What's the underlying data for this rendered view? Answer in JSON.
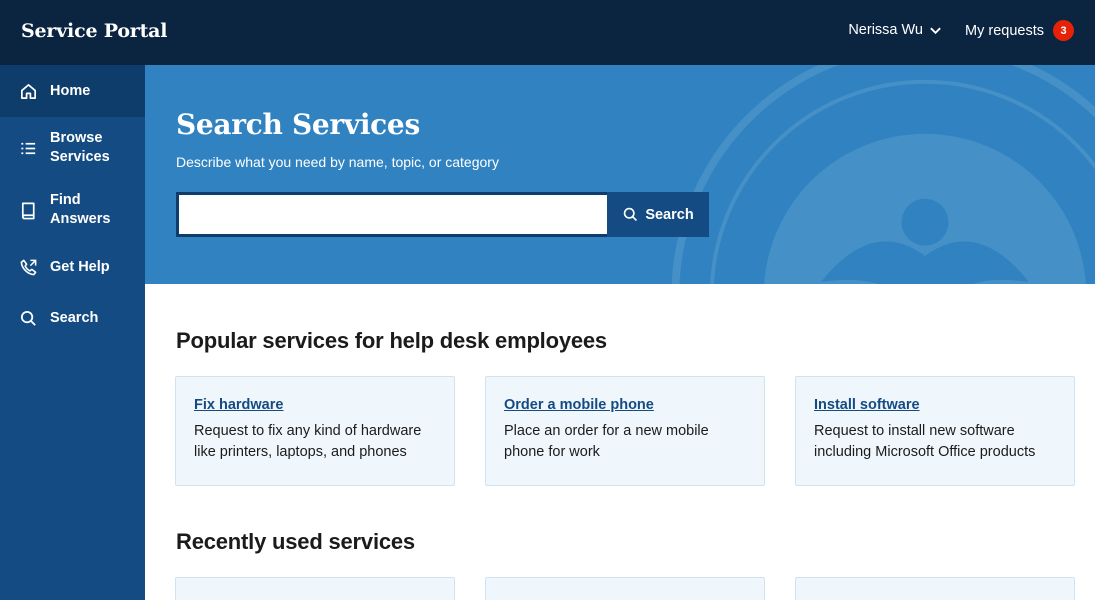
{
  "header": {
    "brand": "Service Portal",
    "user_name": "Nerissa Wu",
    "requests_label": "My requests",
    "requests_count": "3"
  },
  "sidebar": {
    "items": [
      {
        "label": "Home",
        "icon": "home-icon"
      },
      {
        "label": "Browse Services",
        "icon": "list-icon"
      },
      {
        "label": "Find Answers",
        "icon": "book-icon"
      },
      {
        "label": "Get Help",
        "icon": "phone-icon"
      },
      {
        "label": "Search",
        "icon": "search-icon"
      }
    ]
  },
  "hero": {
    "title": "Search Services",
    "subtitle": "Describe what you need by name, topic, or category",
    "search_value": "",
    "search_button": "Search"
  },
  "popular": {
    "title": "Popular services for help desk employees",
    "cards": [
      {
        "title": "Fix hardware",
        "desc": "Request to fix any kind of hardware like printers, laptops, and phones"
      },
      {
        "title": "Order a mobile phone",
        "desc": "Place an order for a new mobile phone for work"
      },
      {
        "title": "Install software",
        "desc": "Request to install new software including Microsoft Office products"
      }
    ]
  },
  "recent": {
    "title": "Recently used services"
  },
  "colors": {
    "topbar": "#0b2440",
    "sidebar": "#144b82",
    "hero": "#3083c0",
    "badge": "#e52207",
    "card_bg": "#f0f7fc"
  }
}
